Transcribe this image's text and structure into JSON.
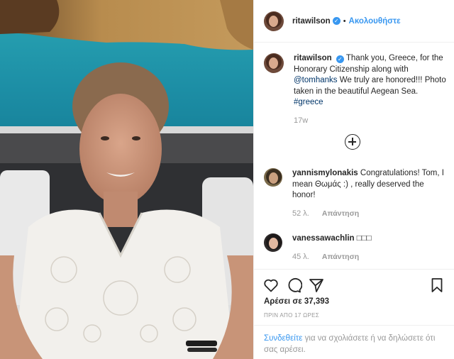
{
  "post": {
    "author": "ritawilson",
    "follow_label": "Ακολουθήστε",
    "separator": "•",
    "caption": {
      "username": "ritawilson",
      "text_1": "Thank you, Greece, for the Honorary Citizenship along with ",
      "mention": "@tomhanks",
      "text_2": " We truly are honored!!! Photo taken in the beautiful Aegean Sea. ",
      "hashtag": "#greece",
      "age": "17w"
    },
    "comments": [
      {
        "username": "yannismylonakis",
        "text": "Congratulations! Tom, I mean Θωμάς :) , really deserved the honor!",
        "likes": "52 λ.",
        "reply": "Απάντηση"
      },
      {
        "username": "vanessawachlin",
        "text": "□□□",
        "likes": "45 λ.",
        "reply": "Απάντηση"
      }
    ],
    "likes_label": "Αρέσει σε 37,393",
    "timestamp": "ΠΡΙΝ ΑΠΟ 17 ΩΡΕΣ",
    "login_prompt": {
      "link": "Συνδεθείτε",
      "text": " για να σχολιάσετε ή να δηλώσετε ότι σας αρέσει."
    }
  },
  "icons": {
    "like": "heart-icon",
    "comment": "comment-icon",
    "share": "share-icon",
    "save": "bookmark-icon",
    "load_more": "plus-circle-icon",
    "verified": "verified-badge-icon"
  },
  "colors": {
    "accent_blue": "#3897f0",
    "link_dark": "#003569",
    "muted": "#999999",
    "border": "#efefef",
    "text": "#262626"
  }
}
